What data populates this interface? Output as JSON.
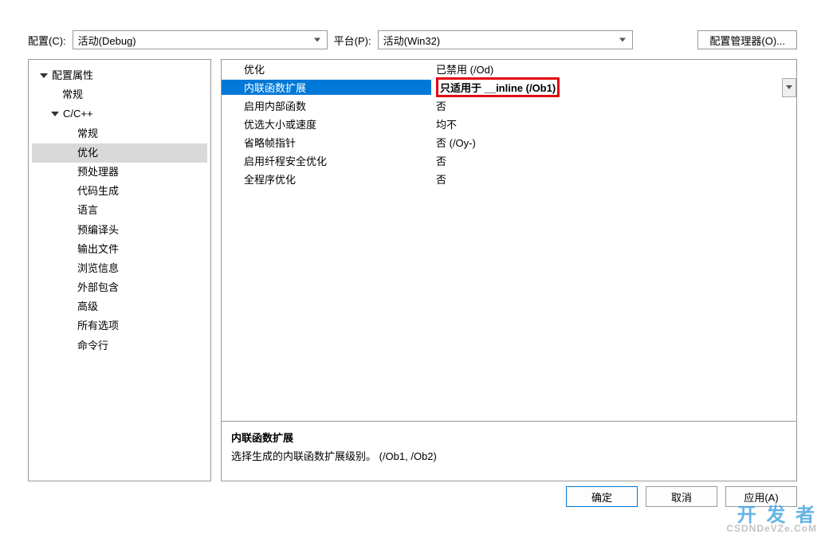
{
  "topbar": {
    "config_label": "配置(C):",
    "config_value": "活动(Debug)",
    "platform_label": "平台(P):",
    "platform_value": "活动(Win32)",
    "manager_btn": "配置管理器(O)..."
  },
  "tree": {
    "root": "配置属性",
    "general": "常规",
    "cpp": "C/C++",
    "cpp_children": [
      "常规",
      "优化",
      "预处理器",
      "代码生成",
      "语言",
      "预编译头",
      "输出文件",
      "浏览信息",
      "外部包含",
      "高级",
      "所有选项",
      "命令行"
    ],
    "selected": "优化"
  },
  "grid": {
    "rows": [
      {
        "name": "优化",
        "value": "已禁用 (/Od)"
      },
      {
        "name": "内联函数扩展",
        "value": "只适用于 __inline (/Ob1)",
        "selected": true,
        "highlight": true,
        "dropdown": true
      },
      {
        "name": "启用内部函数",
        "value": "否"
      },
      {
        "name": "优选大小或速度",
        "value": "均不"
      },
      {
        "name": "省略帧指针",
        "value": "否 (/Oy-)"
      },
      {
        "name": "启用纤程安全优化",
        "value": "否"
      },
      {
        "name": "全程序优化",
        "value": "否"
      }
    ]
  },
  "desc": {
    "title": "内联函数扩展",
    "text": "选择生成的内联函数扩展级别。     (/Ob1, /Ob2)"
  },
  "buttons": {
    "ok": "确定",
    "cancel": "取消",
    "apply": "应用(A)"
  },
  "watermark": {
    "line1": "开 发 者",
    "line2": "CSDNDeVZe.CoM"
  }
}
